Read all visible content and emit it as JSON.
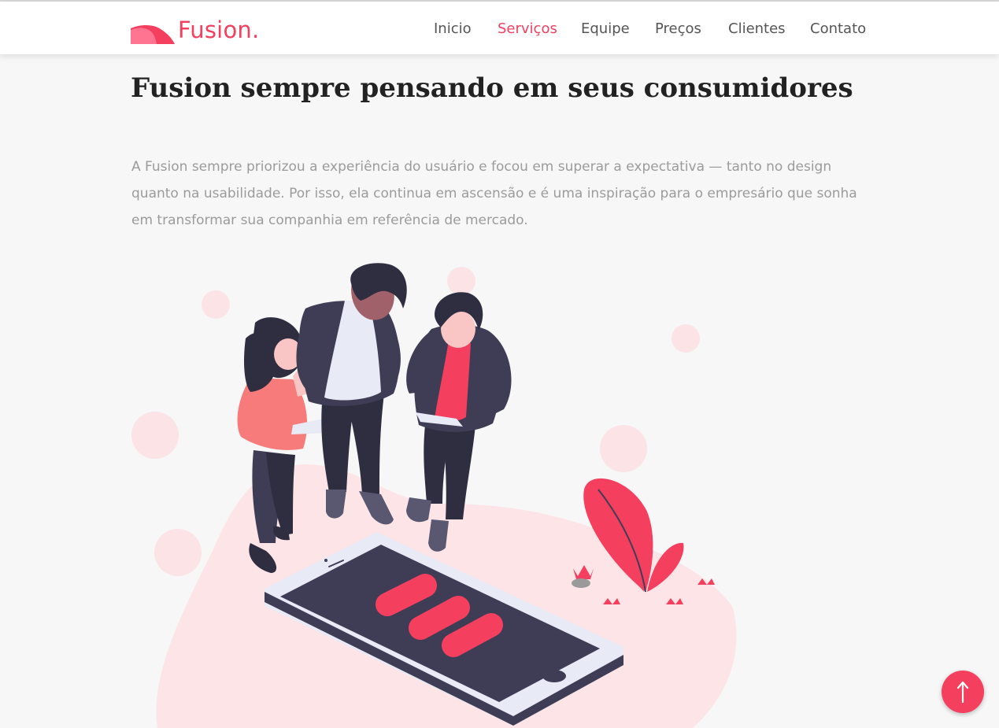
{
  "brand": {
    "name": "Fusion.",
    "accent": "#f43f5e"
  },
  "nav": {
    "items": [
      {
        "label": "Inicio",
        "active": false
      },
      {
        "label": "Serviços",
        "active": true
      },
      {
        "label": "Equipe",
        "active": false
      },
      {
        "label": "Preços",
        "active": false
      },
      {
        "label": "Clientes",
        "active": false
      },
      {
        "label": "Contato",
        "active": false
      }
    ]
  },
  "section": {
    "title": "Fusion sempre pensando em seus consumidores",
    "paragraph": "A Fusion sempre priorizou a experiência do usuário e focou em superar a expectativa — tanto no design quanto na usabilidade. Por isso, ela continua em ascensão e é uma inspiração para o empresário que sonha em transformar sua companhia em referência de mercado."
  },
  "illustration": {
    "icon": "team-smartphone-illustration"
  },
  "back_to_top": {
    "icon": "arrow-up-icon"
  },
  "colors": {
    "primary": "#f43f5e",
    "dark": "#3f3d56",
    "blob": "#fce4e7",
    "text_muted": "#9b9b9b"
  }
}
